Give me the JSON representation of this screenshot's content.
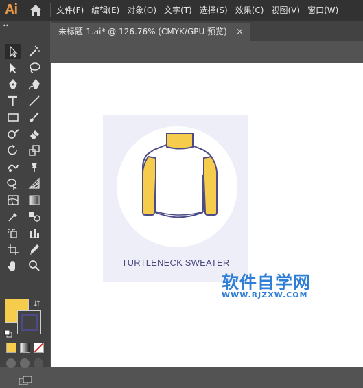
{
  "app": {
    "logo": "Ai"
  },
  "menus": [
    "文件(F)",
    "编辑(E)",
    "对象(O)",
    "文字(T)",
    "选择(S)",
    "效果(C)",
    "视图(V)",
    "窗口(W)"
  ],
  "toolpanel": {
    "collapse_glyph": "◂◂"
  },
  "document": {
    "tab_title": "未标题-1.ai* @ 126.76% (CMYK/GPU 预览)",
    "close_glyph": "×"
  },
  "artwork": {
    "caption": "TURTLENECK SWEATER",
    "colors": {
      "artboard": "#eeeef8",
      "circle": "#ffffff",
      "sweater_body": "#ffffff",
      "sweater_accent": "#f5cc4c",
      "outline": "#4c4b86"
    }
  },
  "swatches": {
    "fill": "#f5cc4c",
    "stroke": "#4c4b86",
    "swap_glyph": "⮃"
  },
  "watermark": {
    "line1": "软件自学网",
    "line2": "WWW.RJZXW.COM"
  }
}
